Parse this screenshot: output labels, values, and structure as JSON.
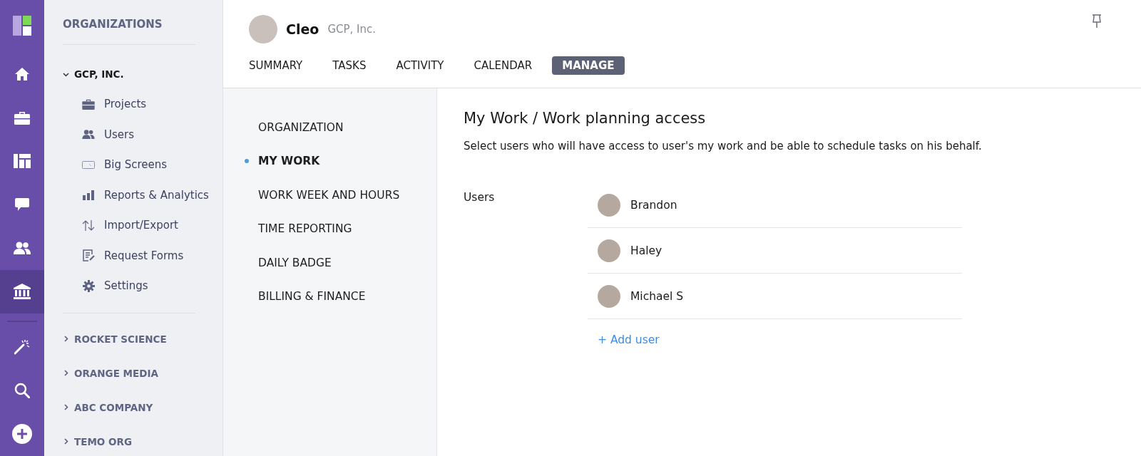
{
  "rail": [
    {
      "kind": "home",
      "selected": false
    },
    {
      "kind": "briefcase",
      "selected": false
    },
    {
      "kind": "board",
      "selected": false
    },
    {
      "kind": "chat",
      "selected": false
    },
    {
      "kind": "users",
      "selected": false
    },
    {
      "kind": "bank",
      "selected": true
    },
    {
      "kind": "wand",
      "selected": false
    },
    {
      "kind": "search",
      "selected": false
    },
    {
      "kind": "plus",
      "selected": false
    }
  ],
  "sidebar": {
    "title": "ORGANIZATIONS",
    "organizations": [
      {
        "name": "GCP, INC.",
        "expanded": true,
        "items": [
          {
            "label": "Projects",
            "kind": "briefcase"
          },
          {
            "label": "Users",
            "kind": "users"
          },
          {
            "label": "Big Screens",
            "kind": "screen"
          },
          {
            "label": "Reports & Analytics",
            "kind": "bars"
          },
          {
            "label": "Import/Export",
            "kind": "arrows"
          },
          {
            "label": "Request Forms",
            "kind": "form"
          },
          {
            "label": "Settings",
            "kind": "gear"
          }
        ]
      },
      {
        "name": "ROCKET SCIENCE",
        "expanded": false
      },
      {
        "name": "ORANGE MEDIA",
        "expanded": false
      },
      {
        "name": "ABC COMPANY",
        "expanded": false
      },
      {
        "name": "TEMO ORG",
        "expanded": false
      }
    ]
  },
  "header": {
    "user_name": "Cleo",
    "organization": "GCP, Inc."
  },
  "tabs": [
    {
      "label": "SUMMARY",
      "selected": false
    },
    {
      "label": "TASKS",
      "selected": false
    },
    {
      "label": "ACTIVITY",
      "selected": false
    },
    {
      "label": "CALENDAR",
      "selected": false
    },
    {
      "label": "MANAGE",
      "selected": true
    }
  ],
  "submenu": [
    {
      "label": "ORGANIZATION",
      "selected": false
    },
    {
      "label": "MY WORK",
      "selected": true
    },
    {
      "label": "WORK WEEK AND HOURS",
      "selected": false
    },
    {
      "label": "TIME REPORTING",
      "selected": false
    },
    {
      "label": "DAILY BADGE",
      "selected": false
    },
    {
      "label": "BILLING & FINANCE",
      "selected": false
    }
  ],
  "content": {
    "title": "My Work / Work planning access",
    "description": "Select users who will have access to user's my work and be able to schedule tasks on his behalf.",
    "users_label": "Users",
    "users": [
      {
        "name": "Brandon"
      },
      {
        "name": "Haley"
      },
      {
        "name": "Michael S"
      }
    ],
    "add_user": "+ Add user"
  }
}
